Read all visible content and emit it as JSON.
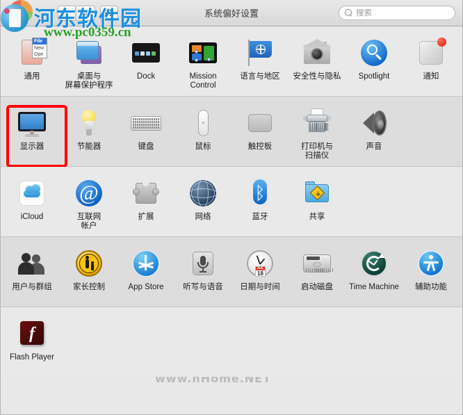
{
  "window": {
    "title": "系统偏好设置"
  },
  "toolbar": {
    "back_label": "‹",
    "forward_label": "›",
    "grid_label": "grid-view",
    "search": {
      "placeholder": "搜索",
      "value": "",
      "clear_label": "✕",
      "icon": "search-icon"
    }
  },
  "highlight": {
    "target": "显示器",
    "color": "#ff0000"
  },
  "watermarks": {
    "logo_text": "河东软件园",
    "site": "www.pc0359.cn",
    "faint": "www.nHome.NET"
  },
  "sections": [
    {
      "id": "personal",
      "shaded": false,
      "items": [
        {
          "label": "通用",
          "icon": "general-icon"
        },
        {
          "label": "桌面与\n屏幕保护程序",
          "icon": "desktop-screensaver-icon"
        },
        {
          "label": "Dock",
          "icon": "dock-icon"
        },
        {
          "label": "Mission\nControl",
          "icon": "mission-control-icon"
        },
        {
          "label": "语言与地区",
          "icon": "language-region-icon"
        },
        {
          "label": "安全性与隐私",
          "icon": "security-privacy-icon"
        },
        {
          "label": "Spotlight",
          "icon": "spotlight-icon"
        },
        {
          "label": "通知",
          "icon": "notifications-icon"
        }
      ]
    },
    {
      "id": "hardware",
      "shaded": true,
      "items": [
        {
          "label": "显示器",
          "icon": "displays-icon"
        },
        {
          "label": "节能器",
          "icon": "energy-saver-icon"
        },
        {
          "label": "键盘",
          "icon": "keyboard-icon"
        },
        {
          "label": "鼠标",
          "icon": "mouse-icon"
        },
        {
          "label": "触控板",
          "icon": "trackpad-icon"
        },
        {
          "label": "打印机与\n扫描仪",
          "icon": "printers-scanners-icon"
        },
        {
          "label": "声音",
          "icon": "sound-icon"
        }
      ]
    },
    {
      "id": "internet",
      "shaded": false,
      "items": [
        {
          "label": "iCloud",
          "icon": "icloud-icon"
        },
        {
          "label": "互联网\n帐户",
          "icon": "internet-accounts-icon"
        },
        {
          "label": "扩展",
          "icon": "extensions-icon"
        },
        {
          "label": "网络",
          "icon": "network-icon"
        },
        {
          "label": "蓝牙",
          "icon": "bluetooth-icon"
        },
        {
          "label": "共享",
          "icon": "sharing-icon"
        }
      ]
    },
    {
      "id": "system",
      "shaded": true,
      "items": [
        {
          "label": "用户与群组",
          "icon": "users-groups-icon"
        },
        {
          "label": "家长控制",
          "icon": "parental-controls-icon"
        },
        {
          "label": "App Store",
          "icon": "app-store-icon"
        },
        {
          "label": "听写与语音",
          "icon": "dictation-speech-icon"
        },
        {
          "label": "日期与时间",
          "icon": "date-time-icon"
        },
        {
          "label": "启动磁盘",
          "icon": "startup-disk-icon"
        },
        {
          "label": "Time Machine",
          "icon": "time-machine-icon"
        },
        {
          "label": "辅助功能",
          "icon": "accessibility-icon"
        }
      ]
    },
    {
      "id": "other",
      "shaded": false,
      "items": [
        {
          "label": "Flash Player",
          "icon": "flash-player-icon"
        }
      ]
    }
  ]
}
